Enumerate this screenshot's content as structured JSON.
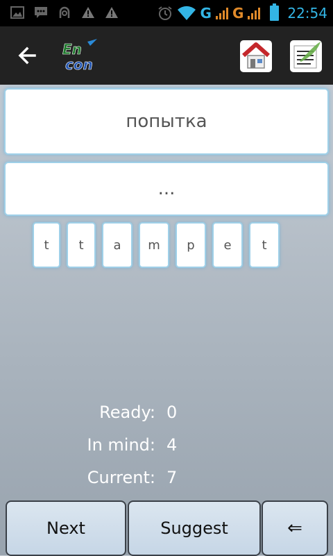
{
  "status_bar": {
    "time": "22:54",
    "network_1": "G",
    "network_2": "G",
    "accent": "#33b5e5",
    "left_icons": [
      "image-icon",
      "chat-icon",
      "android-icon",
      "warning-icon",
      "warning-icon"
    ]
  },
  "action_bar": {
    "logo_text_top": "En",
    "logo_text_bottom": "con"
  },
  "exercise": {
    "word": "попытка",
    "answer": "...",
    "letters": [
      "t",
      "t",
      "a",
      "m",
      "p",
      "e",
      "t"
    ]
  },
  "stats": {
    "ready_label": "Ready:",
    "ready_value": "0",
    "in_mind_label": "In mind:",
    "in_mind_value": "4",
    "current_label": "Current:",
    "current_value": "7"
  },
  "buttons": {
    "next_label": "Next",
    "suggest_label": "Suggest",
    "backspace_label": "⇐"
  }
}
